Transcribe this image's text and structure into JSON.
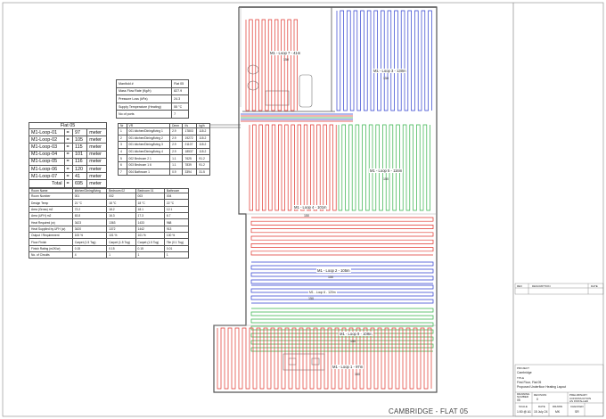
{
  "manifold": {
    "rows": [
      {
        "label": "Manifold #",
        "value": "Flat 05"
      },
      {
        "label": "Mass Flow Rate (Kg/h)",
        "value": "827.9"
      },
      {
        "label": "Pressure Loss (kPa)",
        "value": "24.3"
      },
      {
        "label": "Supply Temperature (Heating)",
        "value": "55 °C"
      },
      {
        "label": "No of ports",
        "value": "7"
      }
    ]
  },
  "flat_table": {
    "title": "Flat 05",
    "rows": [
      {
        "name": "M1-Loop-01",
        "eq": "=",
        "len": "97",
        "unit": "meter"
      },
      {
        "name": "M1-Loop-02",
        "eq": "=",
        "len": "105",
        "unit": "meter"
      },
      {
        "name": "M1-Loop-03",
        "eq": "=",
        "len": "115",
        "unit": "meter"
      },
      {
        "name": "M1-Loop-04",
        "eq": "=",
        "len": "101",
        "unit": "meter"
      },
      {
        "name": "M1-Loop-05",
        "eq": "=",
        "len": "116",
        "unit": "meter"
      },
      {
        "name": "M1-Loop-06",
        "eq": "=",
        "len": "120",
        "unit": "meter"
      },
      {
        "name": "M1-Loop-07",
        "eq": "=",
        "len": "41",
        "unit": "meter"
      }
    ],
    "total_label": "Total",
    "total_eq": "=",
    "total_len": "695",
    "total_unit": "meter"
  },
  "loop_table": {
    "headers": [
      "Nr",
      "VR",
      "Dmm",
      "f/s",
      "kg/h"
    ],
    "rows": [
      [
        "1",
        "001 kitchen/Dining/living 1",
        "2.9",
        "17803",
        "115.2"
      ],
      [
        "2",
        "001 kitchen/Dining/living 2",
        "2.9",
        "19272",
        "115.2"
      ],
      [
        "3",
        "001 kitchen/Dining/living 3",
        "2.9",
        "21107",
        "115.2"
      ],
      [
        "4",
        "001 kitchen/Dining/living 4",
        "2.9",
        "18537",
        "115.2"
      ],
      [
        "5",
        "002 Bedroom 2 1",
        "1.1",
        "7625",
        "91.2"
      ],
      [
        "6",
        "003 Bedroom 1 6",
        "1.1",
        "7839",
        "91.2"
      ],
      [
        "7",
        "004 Bathroom 1",
        "0.9",
        "3394",
        "31.5"
      ]
    ]
  },
  "room_table": {
    "headers": [
      "Room Name",
      "kitchen/Dining/living",
      "Bedroom 02",
      "Bedroom 01",
      "Bathroom"
    ],
    "rows": [
      [
        "Room Number",
        "001",
        "002",
        "003",
        "004"
      ],
      [
        "Design Temp",
        "21 °C",
        "18 °C",
        "18 °C",
        "22 °C"
      ],
      [
        "Area (Gross) m2",
        "72.2",
        "18.2",
        "18.1",
        "12.1"
      ],
      [
        "Area (UFH) m2",
        "63.8",
        "16.3",
        "17.3",
        "6.7"
      ],
      [
        "Heat Required (w)",
        "3423",
        "1363",
        "1433",
        "968"
      ],
      [
        "Heat Supplied by UFH (w)",
        "3420",
        "1372",
        "1442",
        "913"
      ],
      [
        "Output / Requirement",
        "100 %",
        "101 %",
        "101 %",
        "100 %"
      ],
      [
        "Floor Finish",
        "Carpet (1.5 Tog)",
        "Carpet (1.5 Tog)",
        "Carpet (1.5 Tog)",
        "Tile (0.1 Tog)"
      ],
      [
        "Finish Rating (m2K/w)",
        "0.15",
        "0.15",
        "0.15",
        "0.01"
      ],
      [
        "No. of Circuits",
        "4",
        "1",
        "1",
        "1"
      ]
    ]
  },
  "loops": {
    "loop7": "M1 - Loop 7 - 41m",
    "loop7_sub": "150",
    "loop3": "M1 - Loop 3 - 130m",
    "loop3_sub": "150",
    "loop5": "M1 - Loop 5 - 116m",
    "loop5_sub": "150",
    "loop4": "M1 - Loop 4 - 101m",
    "loop4_sub": "150",
    "loop2": "M1 - Loop 2 - 105m",
    "loop2_sub": "150",
    "loop6": "M1 - Loop 6 - 120m",
    "loop6_sub": "150",
    "loop9": "M1 - Loop 9 - 109m",
    "loop9_sub": "150",
    "loop1": "M1 - Loop 1 - 97m",
    "loop1_sub": "150"
  },
  "title_block": {
    "rev_headers": [
      "REV",
      "DESCRIPTION",
      "DATE"
    ],
    "project_label": "PROJECT",
    "project": "Cambridge",
    "title_label": "TITLE",
    "title_line1": "First Floor, Flat 05",
    "title_line2": "Proposed Underfloor Heating Layout",
    "drawing_number_label": "DRAWING NUMBER",
    "drawing_number": "05",
    "revision_label": "REVISION",
    "revision": "0",
    "preliminary": "PRELIMINARY",
    "construction": "CONSTRUCTION",
    "as_installed": "AS INSTALLED",
    "scale_label": "SCALE",
    "scale": "1:50 @ A1",
    "date_label": "DATE",
    "date": "15 July 24",
    "drawn_label": "DRAWN",
    "drawn": "MK",
    "checked_label": "CHECKED",
    "checked": "SR"
  },
  "footer": {
    "title": "CAMBRIDGE - FLAT 05"
  },
  "colors": {
    "loop_red": "#e0342c",
    "loop_blue": "#2f3fcf",
    "loop_green": "#35b24a",
    "wall": "#555555"
  }
}
